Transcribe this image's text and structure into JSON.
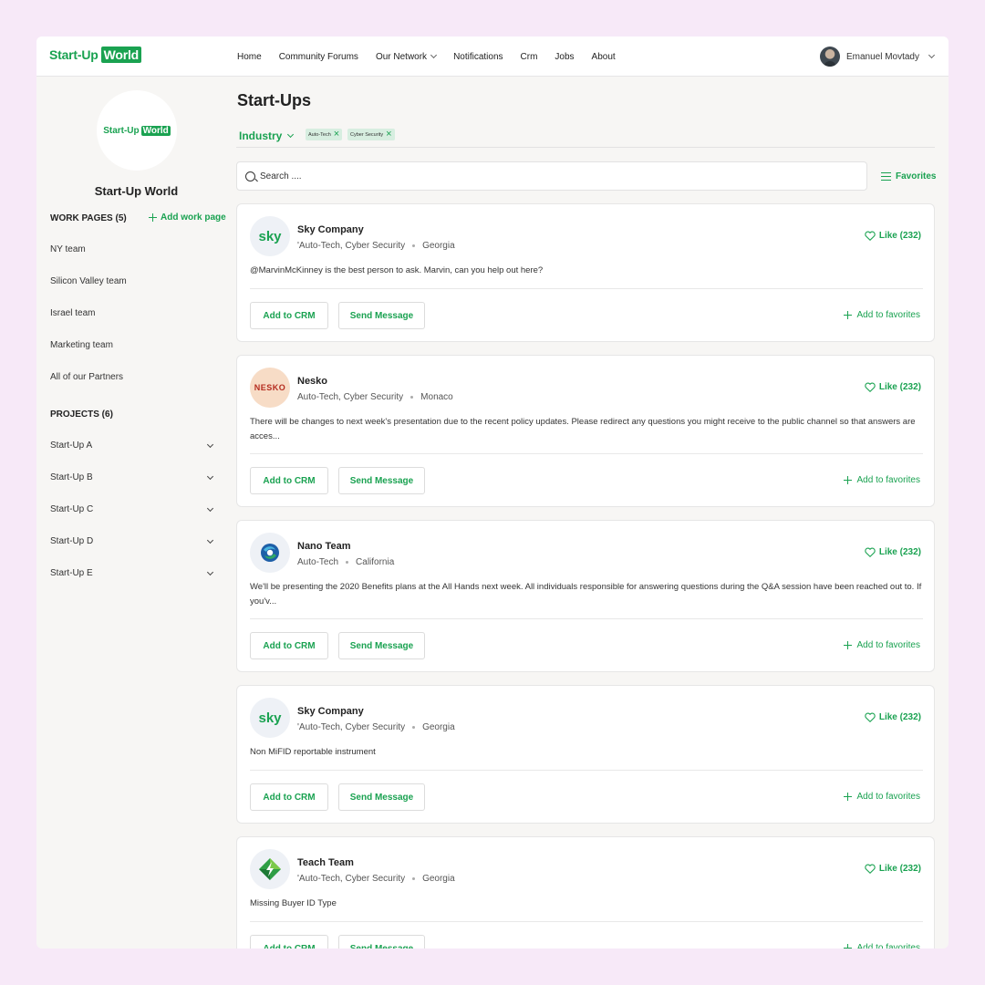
{
  "header": {
    "logo_text": "Start-Up",
    "logo_boxed": "World",
    "nav": [
      {
        "label": "Home"
      },
      {
        "label": "Community Forums"
      },
      {
        "label": "Our Network",
        "dropdown": true
      },
      {
        "label": "Notifications"
      },
      {
        "label": "Crm"
      },
      {
        "label": "Jobs"
      },
      {
        "label": "About"
      }
    ],
    "user_name": "Emanuel Movtady"
  },
  "sidebar": {
    "logo_text": "Start-Up",
    "logo_boxed": "World",
    "title": "Start-Up World",
    "work_pages_heading": "WORK PAGES (5)",
    "add_work_page": "Add work page",
    "work_pages": [
      "NY team",
      "Silicon Valley team",
      "Israel team",
      "Marketing team",
      "All of our Partners"
    ],
    "projects_heading": "PROJECTS (6)",
    "projects": [
      "Start-Up A",
      "Start-Up B",
      "Start-Up C",
      "Start-Up D",
      "Start-Up E"
    ]
  },
  "main": {
    "title": "Start-Ups",
    "filter_label": "Industry",
    "chips": [
      "Auto-Tech",
      "Cyber Security"
    ],
    "search_placeholder": "Search ....",
    "favorites_label": "Favorites",
    "add_crm_label": "Add to CRM",
    "send_message_label": "Send Message",
    "add_favorites_label": "Add to favorites",
    "cards": [
      {
        "name": "Sky Company",
        "industry": "'Auto-Tech, Cyber Security",
        "location": "Georgia",
        "like": "Like (232)",
        "logo": "sky",
        "logo_text": "sky",
        "desc": "@MarvinMcKinney is the best person to ask. Marvin, can you help out here?"
      },
      {
        "name": "Nesko",
        "industry": "Auto-Tech, Cyber Security",
        "location": "Monaco",
        "like": "Like (232)",
        "logo": "nesko",
        "logo_text": "NESKO",
        "desc": "There will be changes to next week's presentation due to the recent policy updates. Please redirect any questions you might receive to the public channel so that answers are acces..."
      },
      {
        "name": "Nano Team",
        "industry": "Auto-Tech",
        "location": "California",
        "like": "Like (232)",
        "logo": "nano",
        "logo_text": "",
        "desc": "We'll be presenting the 2020 Benefits plans at the All Hands next week. All individuals responsible for answering questions during the Q&A session have been reached out to. If you'v..."
      },
      {
        "name": "Sky Company",
        "industry": "'Auto-Tech, Cyber Security",
        "location": "Georgia",
        "like": "Like (232)",
        "logo": "sky",
        "logo_text": "sky",
        "desc": "Non MiFID reportable instrument"
      },
      {
        "name": "Teach Team",
        "industry": "'Auto-Tech, Cyber Security",
        "location": "Georgia",
        "like": "Like (232)",
        "logo": "teach",
        "logo_text": "",
        "desc": "Missing Buyer ID Type"
      }
    ]
  },
  "colors": {
    "accent": "#1aa251",
    "background": "#f7e9f8"
  }
}
